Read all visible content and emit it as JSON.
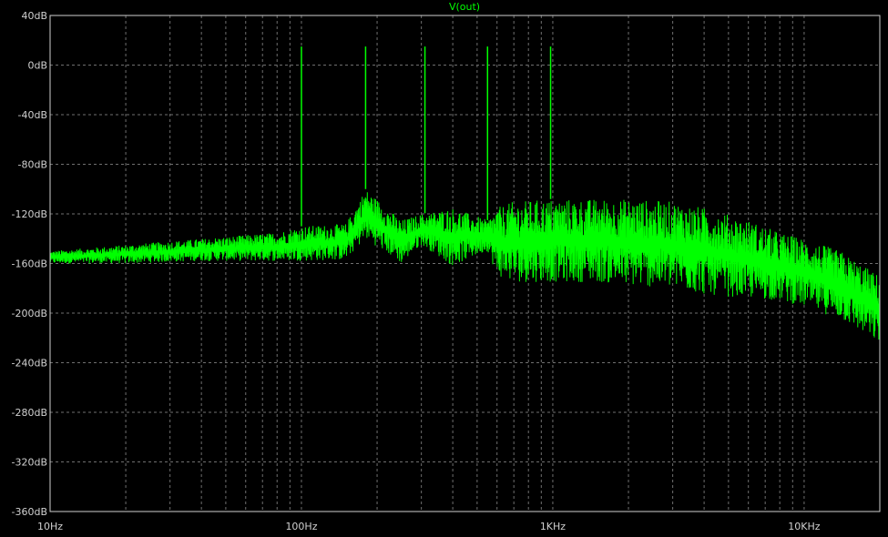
{
  "chart_data": {
    "type": "line",
    "title": "V(out)",
    "xlabel": "",
    "ylabel": "",
    "x_scale": "log",
    "xlim": [
      10,
      20000
    ],
    "ylim": [
      -360,
      40
    ],
    "grid": true,
    "colors": {
      "background": "#000000",
      "trace": "#00ff00",
      "grid": "#6f6f6f",
      "axis_text": "#d0d0d0"
    },
    "y_ticks": [
      40,
      0,
      -40,
      -80,
      -120,
      -160,
      -200,
      -240,
      -280,
      -320,
      -360
    ],
    "y_tick_labels": [
      "40dB",
      "0dB",
      "-40dB",
      "-80dB",
      "-120dB",
      "-160dB",
      "-200dB",
      "-240dB",
      "-280dB",
      "-320dB",
      "-360dB"
    ],
    "x_ticks": [
      10,
      100,
      1000,
      10000
    ],
    "x_tick_labels": [
      "10Hz",
      "100Hz",
      "1KHz",
      "10KHz"
    ],
    "series": [
      {
        "name": "V(out)",
        "floor": {
          "x": [
            10,
            20,
            40,
            80,
            100,
            150,
            180,
            250,
            300,
            400,
            550,
            600,
            700,
            1000,
            1500,
            2000,
            3000,
            4000,
            6000,
            8000,
            10000,
            14000,
            20000
          ],
          "upper": [
            -150,
            -145,
            -140,
            -135,
            -130,
            -128,
            -100,
            -125,
            -120,
            -115,
            -125,
            -115,
            -110,
            -108,
            -108,
            -108,
            -110,
            -115,
            -125,
            -135,
            -140,
            -150,
            -170
          ],
          "lower": [
            -160,
            -160,
            -158,
            -158,
            -158,
            -157,
            -140,
            -160,
            -145,
            -162,
            -150,
            -170,
            -175,
            -175,
            -175,
            -178,
            -180,
            -185,
            -188,
            -190,
            -195,
            -205,
            -225
          ]
        },
        "peaks": [
          {
            "x": 100,
            "y": 15
          },
          {
            "x": 180,
            "y": 15
          },
          {
            "x": 310,
            "y": 15
          },
          {
            "x": 550,
            "y": 15
          },
          {
            "x": 980,
            "y": 15
          }
        ]
      }
    ]
  }
}
